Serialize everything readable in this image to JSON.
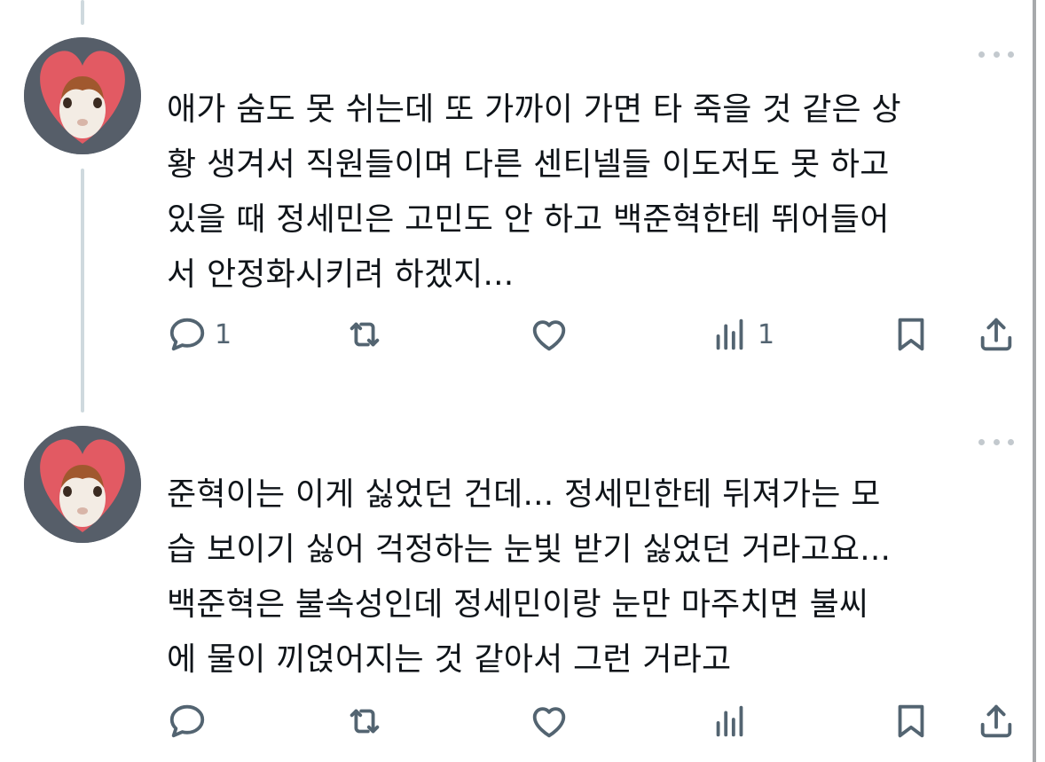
{
  "tweets": [
    {
      "text": "애가 숨도 못 쉬는데 또 가까이 가면 타 죽을 것 같은 상\n황 생겨서 직원들이며 다른 센티넬들 이도저도 못 하고\n있을 때 정세민은 고민도 안 하고 백준혁한테 뛰어들어\n서 안정화시키려 하겠지...",
      "reply_count": "1",
      "retweet_count": "",
      "like_count": "",
      "view_count": "1"
    },
    {
      "text": "준혁이는 이게 싫었던 건데... 정세민한테 뒤져가는 모\n습 보이기 싫어 걱정하는 눈빛 받기 싫었던 거라고요...\n백준혁은 불속성인데 정세민이랑 눈만 마주치면 불씨\n에 물이 끼얹어지는 것 같아서 그런 거라고",
      "reply_count": "",
      "retweet_count": "",
      "like_count": "",
      "view_count": ""
    }
  ],
  "icons": {
    "reply": "reply-icon",
    "retweet": "retweet-icon",
    "like": "like-icon",
    "views": "views-icon",
    "bookmark": "bookmark-icon",
    "share": "share-icon",
    "more": "more-icon"
  },
  "colors": {
    "text": "#0f1419",
    "icon": "#536471",
    "thread_line": "#cfd9de",
    "avatar_heart": "#e25a63"
  }
}
